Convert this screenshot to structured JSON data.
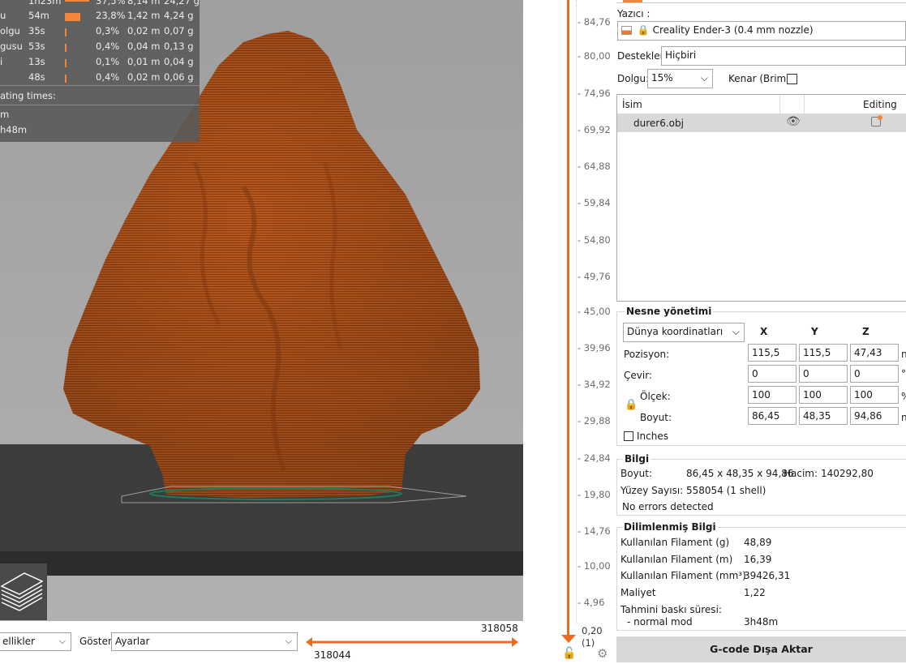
{
  "legend": {
    "rows": [
      {
        "name": "",
        "time": "1h23m",
        "pct": "37,5%",
        "m": "8,14 m",
        "g": "24,27 g"
      },
      {
        "name": "u",
        "time": "54m",
        "pct": "23,8%",
        "m": "1,42 m",
        "g": "4,24 g"
      },
      {
        "name": "olgu",
        "time": "35s",
        "pct": "0,3%",
        "m": "0,02 m",
        "g": "0,07 g"
      },
      {
        "name": "gusu",
        "time": "53s",
        "pct": "0,4%",
        "m": "0,04 m",
        "g": "0,13 g"
      },
      {
        "name": "i",
        "time": "13s",
        "pct": "0,1%",
        "m": "0,01 m",
        "g": "0,04 g"
      },
      {
        "name": "",
        "time": "48s",
        "pct": "0,4%",
        "m": "0,02 m",
        "g": "0,06 g"
      }
    ],
    "estimated_header": "ating times:",
    "estimated_lines": [
      "m",
      "h48m"
    ],
    "bar_color": "#f58638"
  },
  "bottom": {
    "view_combo": "ellikler",
    "show_label": "Göster",
    "show_combo": "Ayarlar",
    "h_slider_top": "318058",
    "h_slider_bottom": "318044"
  },
  "vslider": {
    "ticks": [
      "84,76",
      "80,00",
      "74,96",
      "69,92",
      "64,88",
      "59,84",
      "54,80",
      "49,76",
      "45,00",
      "39,96",
      "34,92",
      "29,88",
      "24,84",
      "19,80",
      "14,76",
      "10,00",
      "4,96"
    ],
    "bottom_value": "0,20",
    "bottom_layer": "(1)"
  },
  "panel": {
    "printer_label": "Yazıcı :",
    "printer_value": "Creality Ender-3 (0.4 mm nozzle)",
    "supports_label": "Destekler:",
    "supports_value": "Hiçbiri",
    "infill_label": "Dolgu:",
    "infill_value": "15%",
    "brim_label": "Kenar (Brim):",
    "list_header_name": "İsim",
    "list_header_editing": "Editing",
    "object_name": "durer6.obj",
    "object_mgmt_title": "Nesne yönetimi",
    "coord_combo": "Dünya koordinatları",
    "axis_x": "X",
    "axis_y": "Y",
    "axis_z": "Z",
    "position_label": "Pozisyon:",
    "position": [
      "115,5",
      "115,5",
      "47,43"
    ],
    "rotate_label": "Çevir:",
    "rotate": [
      "0",
      "0",
      "0"
    ],
    "scale_label": "Ölçek:",
    "scale": [
      "100",
      "100",
      "100"
    ],
    "size_label": "Boyut:",
    "size": [
      "86,45",
      "48,35",
      "94,86"
    ],
    "unit_pos": "n",
    "unit_rot": "°",
    "unit_scale": "%",
    "unit_size": "n",
    "inches_label": "Inches",
    "info_title": "Bilgi",
    "info_size_label": "Boyut:",
    "info_size_value": "86,45 x 48,35 x 94,86",
    "info_volume_label": "Hacim:",
    "info_volume_value": "140292,80",
    "info_facets_label": "Yüzey Sayısı:",
    "info_facets_value": "558054 (1 shell)",
    "info_errors": "No errors detected",
    "sliced_title": "Dilimlenmiş Bilgi",
    "sliced_rows": [
      {
        "label": "Kullanılan Filament (g)",
        "value": "48,89"
      },
      {
        "label": "Kullanılan Filament (m)",
        "value": "16,39"
      },
      {
        "label": "Kullanılan Filament (mm³)",
        "value": "39426,31"
      },
      {
        "label": "Maliyet",
        "value": "1,22"
      }
    ],
    "print_time_label": "Tahmini baskı süresi:",
    "normal_mode_label": "- normal mod",
    "normal_mode_value": "3h48m",
    "export_label": "G-code Dışa Aktar"
  },
  "colors": {
    "model": "#b5561c",
    "accent": "#f58638"
  }
}
